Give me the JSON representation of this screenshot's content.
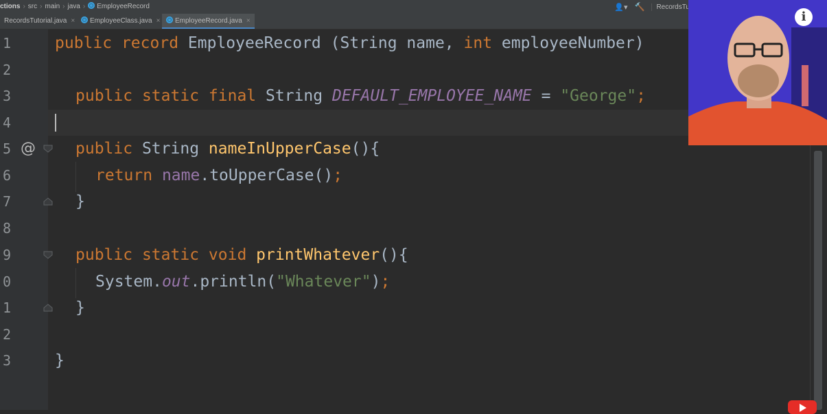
{
  "breadcrumb": {
    "project": "ctions",
    "items": [
      "src",
      "main",
      "java"
    ],
    "file": "EmployeeRecord"
  },
  "toolbar": {
    "run_config": "RecordsTu",
    "user_icon": "user-icon",
    "build_icon": "hammer-icon"
  },
  "tabs": [
    {
      "label": "RecordsTutorial.java",
      "active": false
    },
    {
      "label": "EmployeeClass.java",
      "active": false
    },
    {
      "label": "EmployeeRecord.java",
      "active": true
    }
  ],
  "tab_close": "×",
  "gutter": {
    "line_numbers": [
      "1",
      "2",
      "3",
      "4",
      "5",
      "6",
      "7",
      "8",
      "9",
      "0",
      "1",
      "2",
      "3"
    ],
    "annotation_glyph": "@"
  },
  "code": {
    "l1": {
      "kw1": "public",
      "kw2": "record",
      "name": "EmployeeRecord",
      "p1": " (String name, ",
      "kw3": "int",
      "p2": " employeeNumber)"
    },
    "l3": {
      "kw1": "public",
      "kw2": "static",
      "kw3": "final",
      "type": "String",
      "const": "DEFAULT_EMPLOYEE_NAME",
      "eq": " = ",
      "str": "\"George\"",
      "semi": ";"
    },
    "l5": {
      "kw1": "public",
      "type": "String",
      "fn": "nameInUpperCase",
      "rest": "(){"
    },
    "l6": {
      "kw": "return",
      "fld": "name",
      "rest": ".toUpperCase()",
      "semi": ";"
    },
    "l7": {
      "brace": "}"
    },
    "l9": {
      "kw1": "public",
      "kw2": "static",
      "kw3": "void",
      "fn": "printWhatever",
      "rest": "(){"
    },
    "l10": {
      "cls": "System.",
      "fld": "out",
      "call": ".println(",
      "str": "\"Whatever\"",
      "close": ")",
      "semi": ";"
    },
    "l11": {
      "brace": "}"
    },
    "l13": {
      "brace": "}"
    }
  },
  "overlay": {
    "info_glyph": "i",
    "info_icon": "info-icon",
    "youtube_icon": "youtube-icon"
  },
  "colors": {
    "keyword": "#cc7832",
    "function": "#ffc66d",
    "string": "#6a8759",
    "field": "#9876aa",
    "text": "#a9b7c6",
    "background": "#2b2b2b"
  }
}
